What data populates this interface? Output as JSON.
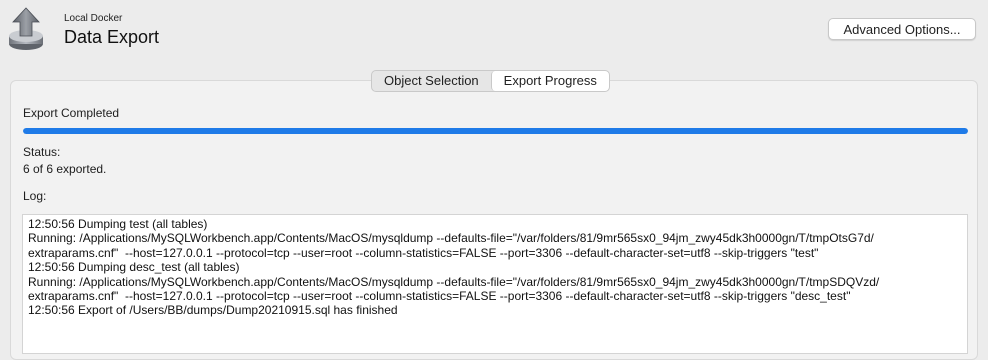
{
  "header": {
    "subtitle": "Local Docker",
    "title": "Data Export",
    "advanced_button": "Advanced Options..."
  },
  "tabs": [
    {
      "label": "Object Selection",
      "active": false
    },
    {
      "label": "Export Progress",
      "active": true
    }
  ],
  "progress": {
    "heading": "Export Completed",
    "fraction": 1.0,
    "color": "#1f7be8"
  },
  "status": {
    "label": "Status:",
    "value": "6 of 6 exported."
  },
  "log": {
    "label": "Log:",
    "lines": [
      "12:50:56 Dumping test (all tables)",
      "Running: /Applications/MySQLWorkbench.app/Contents/MacOS/mysqldump --defaults-file=\"/var/folders/81/9mr565sx0_94jm_zwy45dk3h0000gn/T/tmpOtsG7d/",
      "extraparams.cnf\"  --host=127.0.0.1 --protocol=tcp --user=root --column-statistics=FALSE --port=3306 --default-character-set=utf8 --skip-triggers \"test\"",
      "12:50:56 Dumping desc_test (all tables)",
      "Running: /Applications/MySQLWorkbench.app/Contents/MacOS/mysqldump --defaults-file=\"/var/folders/81/9mr565sx0_94jm_zwy45dk3h0000gn/T/tmpSDQVzd/",
      "extraparams.cnf\"  --host=127.0.0.1 --protocol=tcp --user=root --column-statistics=FALSE --port=3306 --default-character-set=utf8 --skip-triggers \"desc_test\"",
      "12:50:56 Export of /Users/BB/dumps/Dump20210915.sql has finished"
    ]
  }
}
